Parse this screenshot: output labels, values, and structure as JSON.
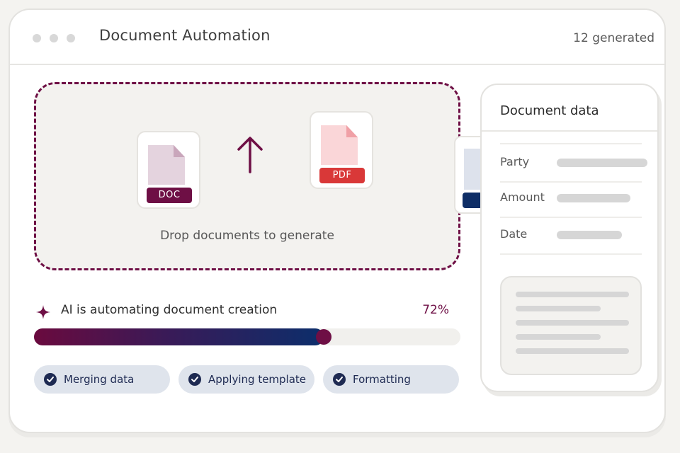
{
  "window": {
    "title": "Document Automation",
    "generated_count": "12 generated",
    "controls": [
      "window-dot",
      "window-dot",
      "window-dot"
    ]
  },
  "dropzone": {
    "text": "Drop documents to generate",
    "source_file": {
      "badge": "DOC",
      "icon": "doc-file-icon"
    },
    "target_file": {
      "badge": "PDF",
      "icon": "pdf-file-icon"
    },
    "arrow_icon": "up-arrow-icon"
  },
  "status": {
    "icon": "sparkle-icon",
    "text": "AI is automating document creation",
    "percent_label": "72%",
    "progress": 0.72
  },
  "steps": [
    {
      "label": "Merging data",
      "icon": "check-circle-icon"
    },
    {
      "label": "Applying template",
      "icon": "check-circle-icon"
    },
    {
      "label": "Formatting",
      "icon": "check-circle-icon"
    }
  ],
  "panel": {
    "title": "Document data",
    "fields": [
      {
        "label": "Party"
      },
      {
        "label": "Amount"
      },
      {
        "label": "Date"
      }
    ]
  },
  "colors": {
    "accent": "#6e0f45",
    "navy": "#0c2e6b",
    "pdf_red": "#d93838",
    "chip_bg": "#dfe4ec"
  }
}
